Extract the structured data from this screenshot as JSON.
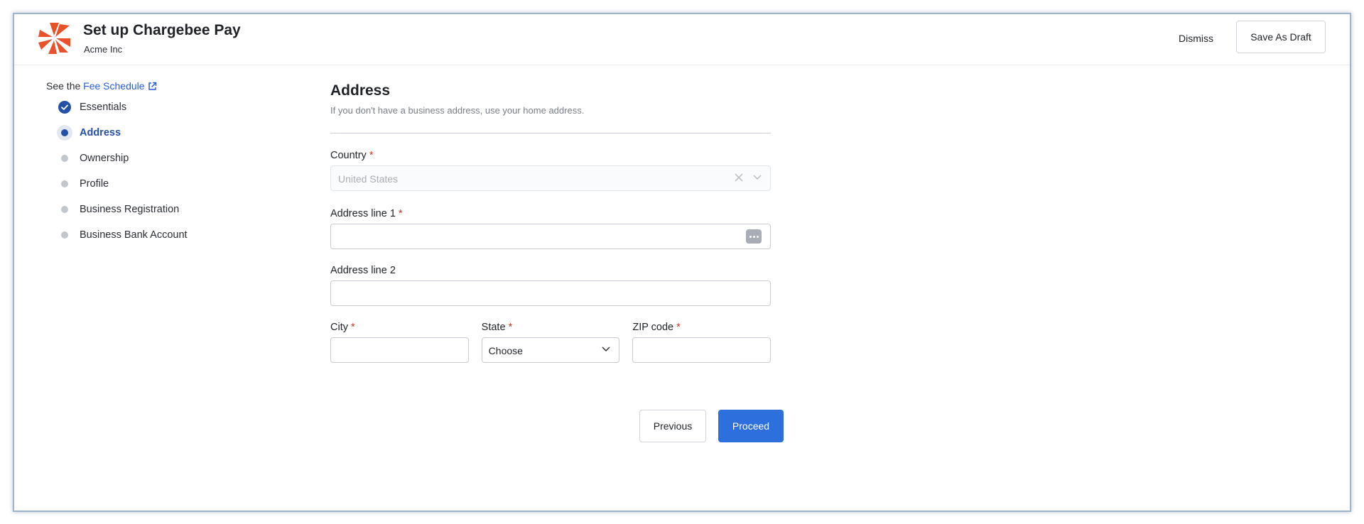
{
  "header": {
    "title": "Set up Chargebee Pay",
    "org": "Acme Inc",
    "dismiss_label": "Dismiss",
    "save_draft_label": "Save As Draft",
    "brand_color": "#e8512a"
  },
  "sidebar": {
    "fee_prefix": "See the",
    "fee_link": "Fee Schedule",
    "steps": [
      {
        "label": "Essentials",
        "status": "complete"
      },
      {
        "label": "Address",
        "status": "active"
      },
      {
        "label": "Ownership",
        "status": "pending"
      },
      {
        "label": "Profile",
        "status": "pending"
      },
      {
        "label": "Business Registration",
        "status": "pending"
      },
      {
        "label": "Business Bank Account",
        "status": "pending"
      }
    ]
  },
  "form": {
    "title": "Address",
    "subtitle": "If you don't have a business address, use your home address.",
    "country_label": "Country",
    "country_value": "United States",
    "address1_label": "Address line 1",
    "address1_value": "",
    "address2_label": "Address line 2",
    "address2_value": "",
    "city_label": "City",
    "city_value": "",
    "state_label": "State",
    "state_value": "Choose",
    "zip_label": "ZIP code",
    "zip_value": "",
    "required_mark": "*"
  },
  "actions": {
    "previous_label": "Previous",
    "proceed_label": "Proceed",
    "accent_color": "#2d6fdc"
  }
}
